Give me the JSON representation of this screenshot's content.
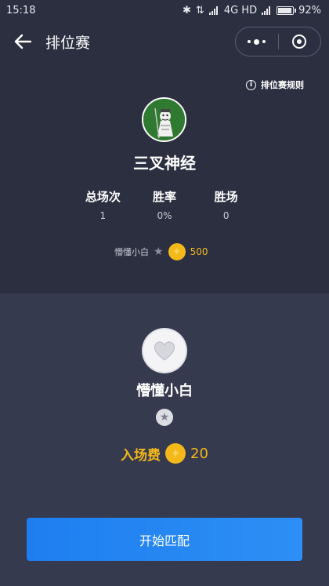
{
  "status_bar": {
    "time": "15:18",
    "network": "4G HD",
    "battery": "92%",
    "battery_level": 0.92
  },
  "header": {
    "title": "排位赛",
    "back_icon": "arrow-left-icon",
    "menu_icon": "more-dots-icon",
    "close_icon": "target-circle-icon"
  },
  "profile": {
    "rules_label": "排位赛规则",
    "username": "三叉神经",
    "stats": [
      {
        "label": "总场次",
        "value": "1"
      },
      {
        "label": "胜率",
        "value": "0%"
      },
      {
        "label": "胜场",
        "value": "0"
      }
    ],
    "rank_label": "懵懂小白",
    "coins": "500"
  },
  "tier": {
    "name": "懵懂小白",
    "fee_label": "入场费",
    "fee_value": "20"
  },
  "action": {
    "start_label": "开始匹配"
  },
  "colors": {
    "background": "#363a4e",
    "panel": "#2c2f40",
    "gold": "#f3b91b",
    "primary": "#1e7ef0"
  }
}
